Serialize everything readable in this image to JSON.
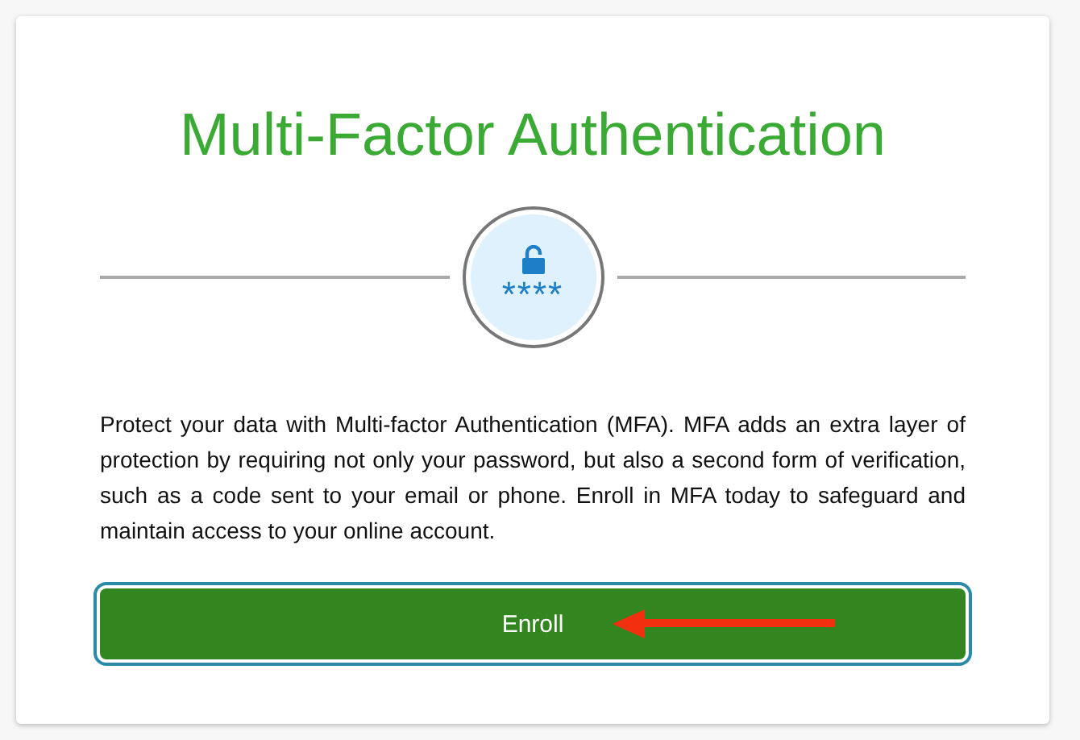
{
  "title": "Multi-Factor Authentication",
  "badge": {
    "mask": "****"
  },
  "description": "Protect your data with Multi-factor Authentication (MFA). MFA adds an extra layer of protection by requiring not only your password, but also a second form of verification, such as a code sent to your email or phone. Enroll in MFA today to safeguard and maintain access to your online account.",
  "button": {
    "label": "Enroll",
    "focused": true
  }
}
